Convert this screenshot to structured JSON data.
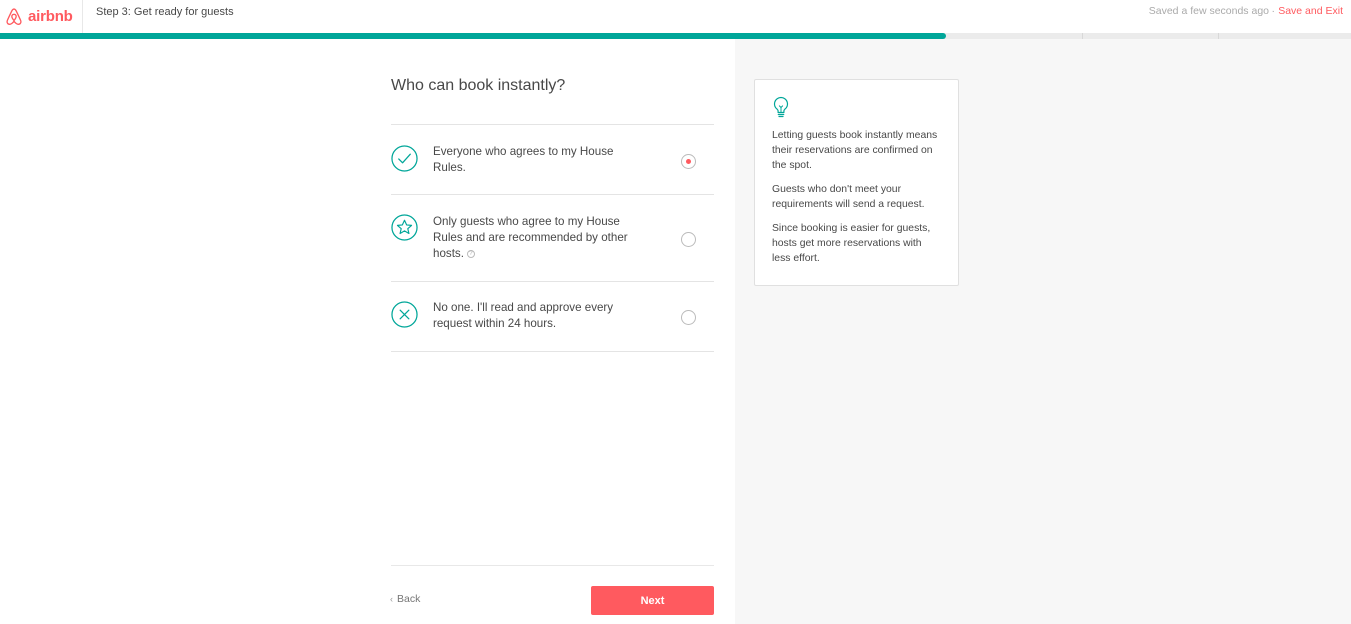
{
  "header": {
    "logo_text": "airbnb",
    "step_title": "Step 3: Get ready for guests",
    "saved_status": "Saved a few seconds ago",
    "separator": "·",
    "save_exit_label": "Save and Exit"
  },
  "progress": {
    "fraction": 0.7,
    "segments": 4
  },
  "question": "Who can book instantly?",
  "options": [
    {
      "label": "Everyone who agrees to my House Rules.",
      "icon": "check-circle-icon",
      "selected": true
    },
    {
      "label": "Only guests who agree to my House Rules and are recommended by other hosts.",
      "icon": "star-circle-icon",
      "selected": false,
      "help": "?"
    },
    {
      "label": "No one. I'll read and approve every request within 24 hours.",
      "icon": "x-circle-icon",
      "selected": false
    }
  ],
  "tip": {
    "icon": "lightbulb-icon",
    "paragraphs": [
      "Letting guests book instantly means their reservations are confirmed on the spot.",
      "Guests who don't meet your requirements will send a request.",
      "Since booking is easier for guests, hosts get more reservations with less effort."
    ]
  },
  "footer": {
    "back_arrow": "‹",
    "back_label": "Back",
    "next_label": "Next"
  },
  "colors": {
    "brand": "#FF5A5F",
    "accent": "#00A699",
    "panel_bg": "#f7f7f7"
  }
}
